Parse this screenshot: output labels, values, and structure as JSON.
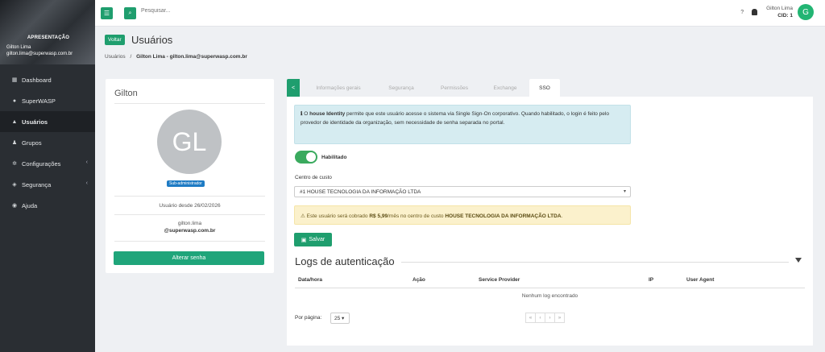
{
  "sidebar": {
    "role": "APRESENTAÇÃO",
    "user_name": "Gilton Lima",
    "user_email": "gilton.lima@superwasp.com.br",
    "items": [
      {
        "label": "Dashboard",
        "icon": "dashboard-icon"
      },
      {
        "label": "SuperWASP",
        "icon": "chat-icon"
      },
      {
        "label": "Usuários",
        "icon": "user-icon",
        "active": true
      },
      {
        "label": "Grupos",
        "icon": "users-icon"
      },
      {
        "label": "Configurações",
        "icon": "gear-icon"
      },
      {
        "label": "Segurança",
        "icon": "shield-icon"
      },
      {
        "label": "Ajuda",
        "icon": "help-icon"
      }
    ]
  },
  "topbar": {
    "search_placeholder": "Pesquisar...",
    "user_name": "Gilton Lima",
    "user_id": "CID: 1",
    "avatar_letter": "G",
    "help_glyph": "?",
    "menu_glyph": "☰",
    "search_glyph": "🔍"
  },
  "header": {
    "back_label": "Voltar",
    "title": "Usuários",
    "breadcrumb_root": "Usuários",
    "breadcrumb_sep": "/",
    "breadcrumb_current": "Gilton Lima - gilton.lima@superwasp.com.br"
  },
  "profile": {
    "name": "Gilton",
    "initials": "GL",
    "badge": "Sub-administrador",
    "since": "Usuário desde 26/02/2026",
    "login_line1": "gilton.lima",
    "login_line2": "@superwasp.com.br",
    "change_password": "Alterar senha"
  },
  "tabs": {
    "toggle_glyph": "<",
    "items": [
      "Informações gerais",
      "Segurança",
      "Permissões",
      "Exchange",
      "SSO"
    ],
    "active": "SSO"
  },
  "sso": {
    "info_prefix": "O",
    "info_brand": "house Identity",
    "info_text": "permite que este usuário acesse o sistema via Single Sign-On corporativo. Quando habilitado, o login é feito pelo provedor de identidade da organização, sem necessidade de senha separada no portal.",
    "enabled_label": "Habilitado",
    "enabled": true,
    "cost_center_label": "Centro de custo",
    "cost_center_value": "#1 HOUSE TECNOLOGIA DA INFORMAÇÃO LTDA",
    "warn_prefix": "Este usuário será cobrado",
    "warn_amount": "R$ 5,99",
    "warn_middle": "/mês no centro de custo",
    "warn_company": "HOUSE TECNOLOGIA DA INFORMAÇÃO LTDA",
    "warn_suffix": ".",
    "save_label": "Salvar"
  },
  "logs": {
    "title": "Logs de autenticação",
    "columns": [
      "Data/hora",
      "Ação",
      "Service Provider",
      "IP",
      "User Agent"
    ],
    "empty": "Nenhum log encontrado",
    "per_page_label": "Por página:",
    "per_page_value": "25",
    "pager": [
      "«",
      "‹",
      "›",
      "»"
    ]
  }
}
